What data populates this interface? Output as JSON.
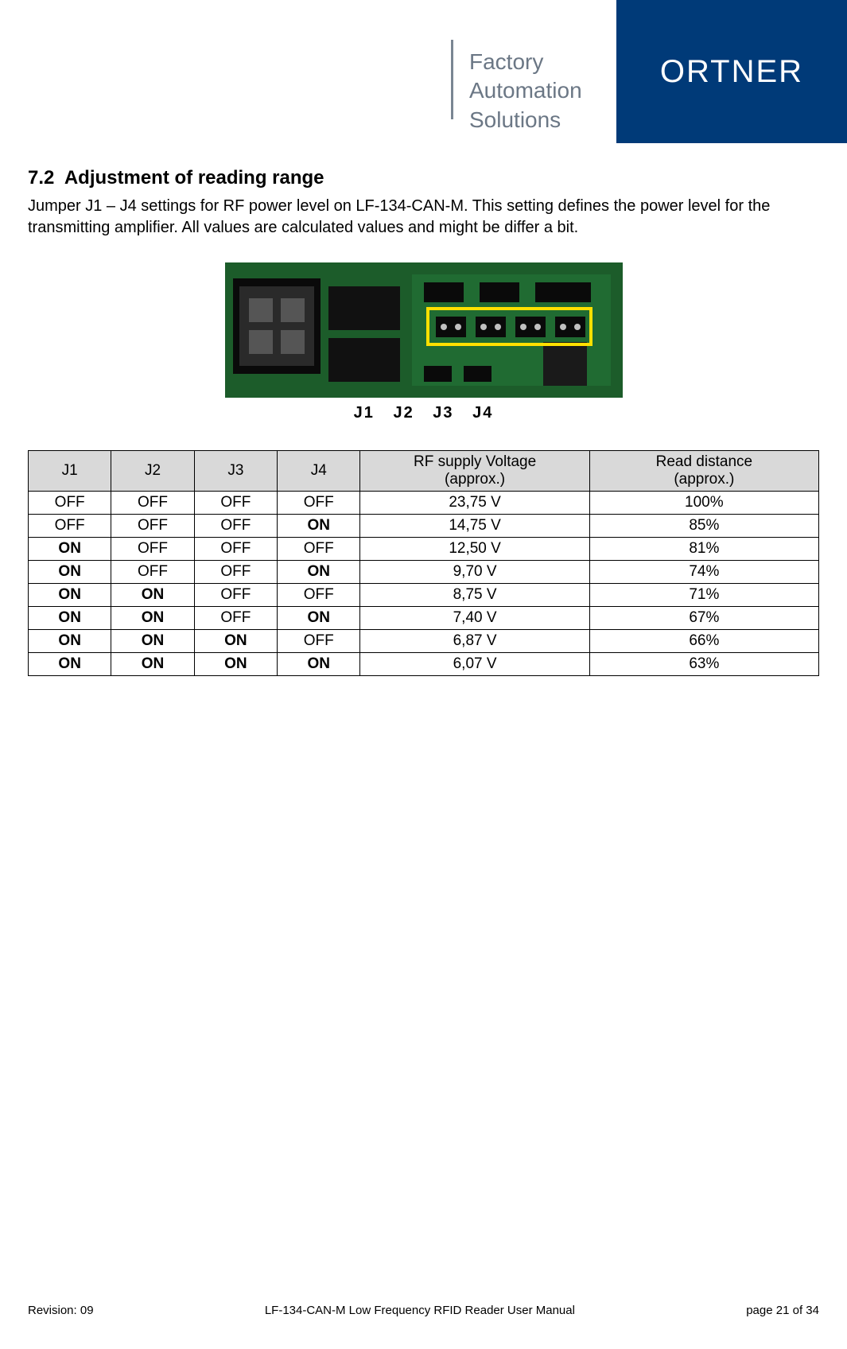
{
  "header": {
    "tagline_l1": "Factory",
    "tagline_l2": "Automation",
    "tagline_l3": "Solutions",
    "brand": "ORTNER"
  },
  "section": {
    "number": "7.2",
    "title": "Adjustment of reading range",
    "intro": "Jumper J1 – J4 settings for RF power level on LF-134-CAN-M. This setting defines the power level for the transmitting amplifier. All values are calculated values and might be differ a bit."
  },
  "figure": {
    "jumper_labels": "J1 J2 J3 J4"
  },
  "table": {
    "headers": {
      "j1": "J1",
      "j2": "J2",
      "j3": "J3",
      "j4": "J4",
      "rf_l1": "RF supply Voltage",
      "rf_l2": "(approx.)",
      "rd_l1": "Read distance",
      "rd_l2": "(approx.)"
    },
    "rows": [
      {
        "j1": "OFF",
        "j1b": false,
        "j2": "OFF",
        "j2b": false,
        "j3": "OFF",
        "j3b": false,
        "j4": "OFF",
        "j4b": false,
        "rf": "23,75 V",
        "rd": "100%"
      },
      {
        "j1": "OFF",
        "j1b": false,
        "j2": "OFF",
        "j2b": false,
        "j3": "OFF",
        "j3b": false,
        "j4": "ON",
        "j4b": true,
        "rf": "14,75 V",
        "rd": "85%"
      },
      {
        "j1": "ON",
        "j1b": true,
        "j2": "OFF",
        "j2b": false,
        "j3": "OFF",
        "j3b": false,
        "j4": "OFF",
        "j4b": false,
        "rf": "12,50 V",
        "rd": "81%"
      },
      {
        "j1": "ON",
        "j1b": true,
        "j2": "OFF",
        "j2b": false,
        "j3": "OFF",
        "j3b": false,
        "j4": "ON",
        "j4b": true,
        "rf": "9,70 V",
        "rd": "74%"
      },
      {
        "j1": "ON",
        "j1b": true,
        "j2": "ON",
        "j2b": true,
        "j3": "OFF",
        "j3b": false,
        "j4": "OFF",
        "j4b": false,
        "rf": "8,75 V",
        "rd": "71%"
      },
      {
        "j1": "ON",
        "j1b": true,
        "j2": "ON",
        "j2b": true,
        "j3": "OFF",
        "j3b": false,
        "j4": "ON",
        "j4b": true,
        "rf": "7,40 V",
        "rd": "67%"
      },
      {
        "j1": "ON",
        "j1b": true,
        "j2": "ON",
        "j2b": true,
        "j3": "ON",
        "j3b": true,
        "j4": "OFF",
        "j4b": false,
        "rf": "6,87 V",
        "rd": "66%"
      },
      {
        "j1": "ON",
        "j1b": true,
        "j2": "ON",
        "j2b": true,
        "j3": "ON",
        "j3b": true,
        "j4": "ON",
        "j4b": true,
        "rf": "6,07 V",
        "rd": "63%"
      }
    ]
  },
  "footer": {
    "revision": "Revision: 09",
    "doc_title": "LF-134-CAN-M Low Frequency RFID Reader User Manual",
    "page": "page 21 of 34"
  }
}
